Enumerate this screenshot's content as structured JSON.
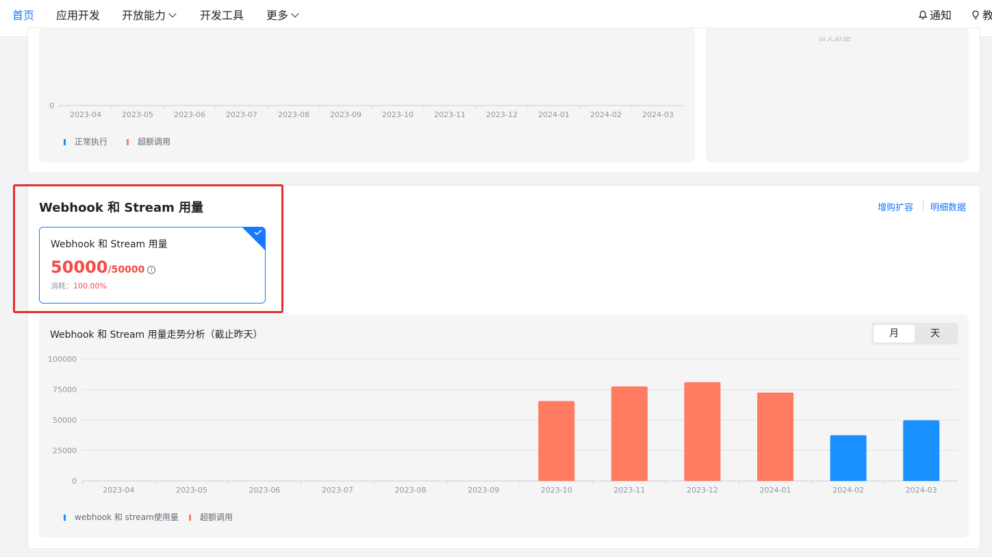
{
  "nav": {
    "items": [
      {
        "label": "首页",
        "active": true,
        "dropdown": false
      },
      {
        "label": "应用开发",
        "active": false,
        "dropdown": false
      },
      {
        "label": "开放能力",
        "active": false,
        "dropdown": true
      },
      {
        "label": "开发工具",
        "active": false,
        "dropdown": false
      },
      {
        "label": "更多",
        "active": false,
        "dropdown": true
      }
    ],
    "notify_label": "通知",
    "right_cut_label": "教"
  },
  "top_chart": {
    "y_zero": "0",
    "x_ticks": [
      "2023-04",
      "2023-05",
      "2023-06",
      "2023-07",
      "2023-08",
      "2023-09",
      "2023-10",
      "2023-11",
      "2023-12",
      "2024-01",
      "2024-02",
      "2024-03"
    ],
    "legend": [
      {
        "name": "正常执行",
        "color": "#1890ff"
      },
      {
        "name": "超额调用",
        "color": "#ff7b62"
      }
    ],
    "side_panel_text": "暂无数据"
  },
  "section": {
    "title": "Webhook 和 Stream 用量",
    "links": {
      "buy": "增购扩容",
      "detail": "明细数据"
    }
  },
  "usage_card": {
    "title": "Webhook 和 Stream 用量",
    "used": "50000",
    "total": "/50000",
    "info_icon": "i",
    "consume_label": "消耗：",
    "consume_pct": "100.00%"
  },
  "trend": {
    "title": "Webhook 和 Stream 用量走势分析（截止昨天）",
    "toggle": {
      "month": "月",
      "day": "天",
      "active": "month"
    }
  },
  "chart_data": {
    "type": "bar",
    "categories": [
      "2023-04",
      "2023-05",
      "2023-06",
      "2023-07",
      "2023-08",
      "2023-09",
      "2023-10",
      "2023-11",
      "2023-12",
      "2024-01",
      "2024-02",
      "2024-03"
    ],
    "series": [
      {
        "name": "webhook 和 stream使用量",
        "color": "#1890ff",
        "values": [
          0,
          0,
          0,
          0,
          0,
          0,
          0,
          0,
          0,
          0,
          37500,
          49700
        ]
      },
      {
        "name": "超额调用",
        "color": "#ff7b62",
        "values": [
          0,
          0,
          0,
          0,
          0,
          0,
          65500,
          77500,
          81000,
          72500,
          0,
          0
        ]
      }
    ],
    "ylim": [
      0,
      100000
    ],
    "yticks": [
      "100000",
      "75000",
      "50000",
      "25000",
      "0"
    ],
    "grid": true,
    "legend_position": "bottom-left"
  }
}
